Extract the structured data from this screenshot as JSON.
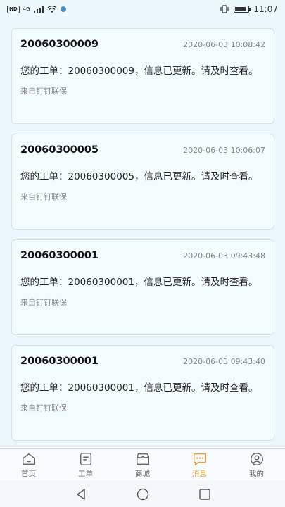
{
  "status": {
    "hd": "HD",
    "net": "4G",
    "time": "11:07",
    "battery_level": 0.85
  },
  "messages": [
    {
      "title": "20060300009",
      "time": "2020-06-03 10:08:42",
      "body": "您的工单：20060300009，信息已更新。请及时查看。",
      "source": "来自钉钉联保"
    },
    {
      "title": "20060300005",
      "time": "2020-06-03 10:06:07",
      "body": "您的工单：20060300005，信息已更新。请及时查看。",
      "source": "来自钉钉联保"
    },
    {
      "title": "20060300001",
      "time": "2020-06-03 09:43:48",
      "body": "您的工单：20060300001，信息已更新。请及时查看。",
      "source": "来自钉钉联保"
    },
    {
      "title": "20060300001",
      "time": "2020-06-03 09:43:40",
      "body": "您的工单：20060300001，信息已更新。请及时查看。",
      "source": "来自钉钉联保"
    }
  ],
  "tabs": [
    {
      "label": "首页",
      "icon": "home-icon"
    },
    {
      "label": "工单",
      "icon": "workorder-icon"
    },
    {
      "label": "商城",
      "icon": "store-icon"
    },
    {
      "label": "消息",
      "icon": "message-icon"
    },
    {
      "label": "我的",
      "icon": "profile-icon"
    }
  ],
  "active_tab": "消息",
  "colors": {
    "accent": "#e6a23c",
    "background": "#ecf7fb",
    "card": "#f2fbfd"
  }
}
